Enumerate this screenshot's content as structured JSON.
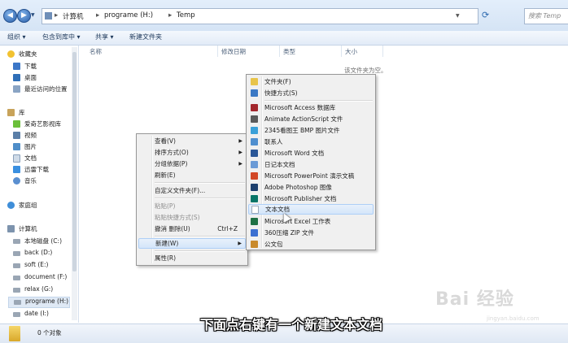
{
  "address": {
    "crumbs": [
      "计算机",
      "programe (H:)",
      "Temp"
    ],
    "search_placeholder": "搜索 Temp"
  },
  "toolbar": {
    "organize": "组织 ▾",
    "include": "包含到库中 ▾",
    "share": "共享 ▾",
    "new_folder": "新建文件夹"
  },
  "nav": {
    "favorites": "收藏夹",
    "favorites_items": [
      "下载",
      "桌面",
      "最近访问的位置"
    ],
    "libraries": "库",
    "library_items": [
      "爱奇艺影视库",
      "视频",
      "图片",
      "文档",
      "迅雷下载",
      "音乐"
    ],
    "homegroup": "家庭组",
    "computer": "计算机",
    "drives": [
      "本地磁盘 (C:)",
      "back (D:)",
      "soft (E:)",
      "document (F:)",
      "relax (G:)",
      "programe (H:)",
      "date (I:)"
    ]
  },
  "columns": {
    "name": "名称",
    "date": "修改日期",
    "type": "类型",
    "size": "大小"
  },
  "empty_text": "该文件夹为空。",
  "status_text": "0 个对象",
  "context_menu": {
    "items": [
      {
        "label": "查看(V)",
        "arrow": true
      },
      {
        "label": "排序方式(O)",
        "arrow": true
      },
      {
        "label": "分组依据(P)",
        "arrow": true
      },
      {
        "label": "刷新(E)"
      },
      {
        "label": "自定义文件夹(F)..."
      },
      {
        "label": "粘贴(P)",
        "disabled": true
      },
      {
        "label": "粘贴快捷方式(S)",
        "disabled": true
      },
      {
        "label": "撤消 删除(U)",
        "shortcut": "Ctrl+Z"
      },
      {
        "label": "新建(W)",
        "arrow": true
      },
      {
        "label": "属性(R)"
      }
    ]
  },
  "new_submenu": {
    "items": [
      {
        "label": "文件夹(F)",
        "icon_color": "#e8c44a"
      },
      {
        "label": "快捷方式(S)",
        "icon_color": "#3a78c4"
      },
      {
        "label": "Microsoft Access 数据库",
        "icon_color": "#a3262c"
      },
      {
        "label": "Animate ActionScript 文件",
        "icon_color": "#5a5a5a"
      },
      {
        "label": "2345看图王 BMP 图片文件",
        "icon_color": "#3aa0d8"
      },
      {
        "label": "联系人",
        "icon_color": "#4f8fcf"
      },
      {
        "label": "Microsoft Word 文档",
        "icon_color": "#2b5797"
      },
      {
        "label": "日记本文档",
        "icon_color": "#6a9ad6"
      },
      {
        "label": "Microsoft PowerPoint 演示文稿",
        "icon_color": "#d24726"
      },
      {
        "label": "Adobe Photoshop 图像",
        "icon_color": "#1c3f6e"
      },
      {
        "label": "Microsoft Publisher 文档",
        "icon_color": "#077568"
      },
      {
        "label": "文本文档",
        "icon_color": "#cfd8e3",
        "highlighted": true
      },
      {
        "label": "Microsoft Excel 工作表",
        "icon_color": "#1e7145"
      },
      {
        "label": "360压缩 ZIP 文件",
        "icon_color": "#3b6fd1"
      },
      {
        "label": "公文包",
        "icon_color": "#c98a2b"
      }
    ]
  },
  "watermark": {
    "main": "Bai 经验",
    "sub": "jingyan.baidu.com"
  },
  "subtitle": "下面点右键有一个新建文本文档"
}
